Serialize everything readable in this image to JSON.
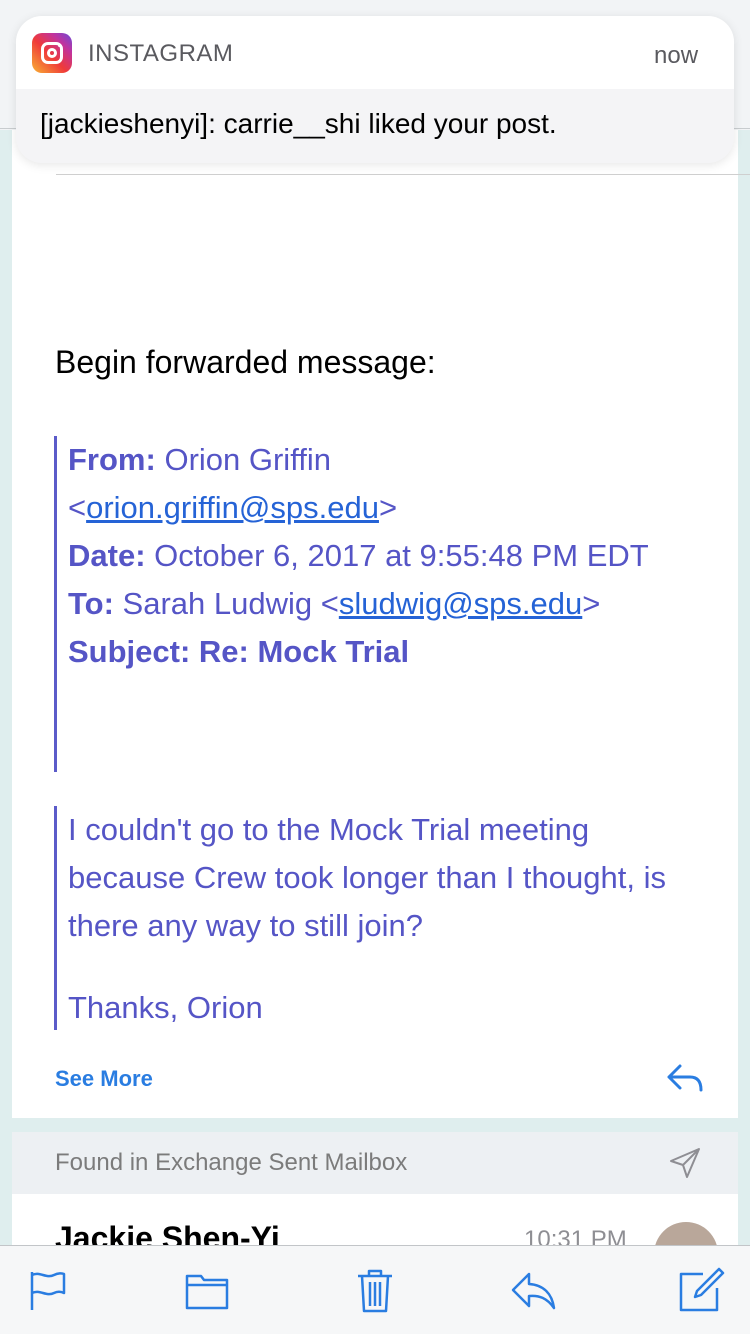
{
  "notification": {
    "app_name": "INSTAGRAM",
    "time": "now",
    "message": "[jackieshenyi]: carrie__shi liked your post."
  },
  "email": {
    "forward_heading": "Begin forwarded message:",
    "header": {
      "from_label": "From:",
      "from_name": "Orion Griffin",
      "from_email": "orion.griffin@sps.edu",
      "date_label": "Date:",
      "date_value": "October 6, 2017 at 9:55:48 PM EDT",
      "to_label": "To:",
      "to_name": "Sarah Ludwig",
      "to_email": "sludwig@sps.edu",
      "subject_label": "Subject:",
      "subject_value": "Re: Mock Trial"
    },
    "body": {
      "text": "I couldn't go to the Mock Trial meeting because Crew took longer than I thought, is there any way to still join?",
      "signature": "Thanks, Orion"
    },
    "see_more": "See More"
  },
  "found_banner": {
    "text": "Found in Exchange Sent Mailbox"
  },
  "next_message": {
    "sender": "Jackie Shen-Yi",
    "time": "10:31 PM"
  },
  "colors": {
    "quote_text": "#5555c6",
    "link": "#2563d6",
    "accent": "#2a7de1"
  },
  "icons": {
    "toolbar": [
      "flag-icon",
      "folder-icon",
      "trash-icon",
      "reply-icon",
      "compose-icon"
    ]
  }
}
